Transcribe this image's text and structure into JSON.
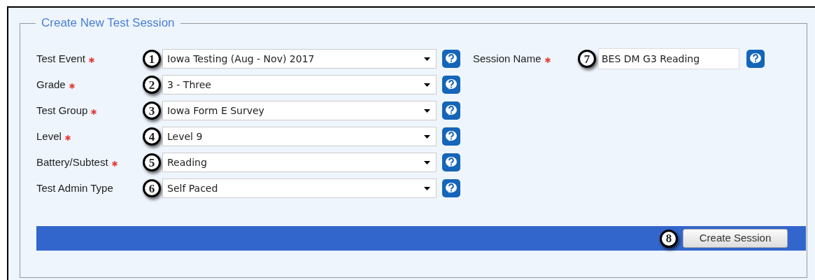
{
  "fieldset": {
    "legend": "Create New Test Session"
  },
  "fields": [
    {
      "label": "Test Event",
      "required": true,
      "callout": "1",
      "value": "Iowa Testing (Aug - Nov) 2017"
    },
    {
      "label": "Grade",
      "required": true,
      "callout": "2",
      "value": "3 - Three"
    },
    {
      "label": "Test Group",
      "required": true,
      "callout": "3",
      "value": "Iowa Form E Survey"
    },
    {
      "label": "Level",
      "required": true,
      "callout": "4",
      "value": "Level 9"
    },
    {
      "label": "Battery/Subtest",
      "required": true,
      "callout": "5",
      "value": "Reading"
    },
    {
      "label": "Test Admin Type",
      "required": false,
      "callout": "6",
      "value": "Self Paced"
    }
  ],
  "session_name": {
    "label": "Session Name",
    "required": true,
    "callout": "7",
    "value": "BES DM G3 Reading"
  },
  "action_bar": {
    "callout": "8",
    "button": "Create Session"
  }
}
